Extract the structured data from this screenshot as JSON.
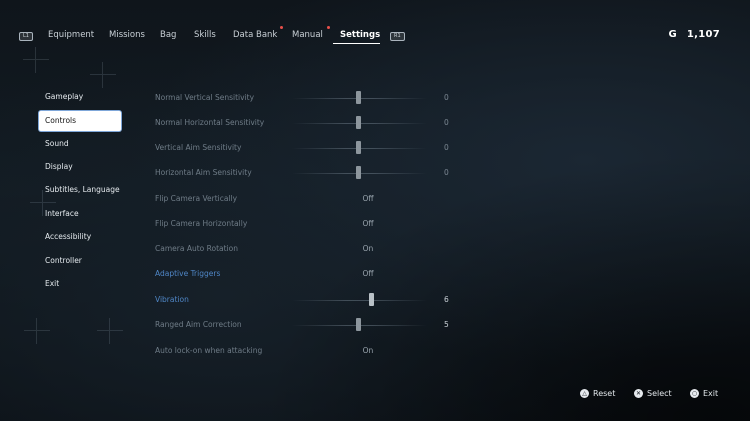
{
  "topbar": {
    "left_shoulder": "L1",
    "right_shoulder": "R1",
    "tabs": [
      {
        "label": "Equipment",
        "active": false,
        "notification": false
      },
      {
        "label": "Missions",
        "active": false,
        "notification": false
      },
      {
        "label": "Bag",
        "active": false,
        "notification": false
      },
      {
        "label": "Skills",
        "active": false,
        "notification": false
      },
      {
        "label": "Data Bank",
        "active": false,
        "notification": true
      },
      {
        "label": "Manual",
        "active": false,
        "notification": true
      },
      {
        "label": "Settings",
        "active": true,
        "notification": false
      }
    ],
    "currency": {
      "symbol": "G",
      "amount": "1,107"
    }
  },
  "sidebar": {
    "items": [
      {
        "label": "Gameplay",
        "selected": false
      },
      {
        "label": "Controls",
        "selected": true
      },
      {
        "label": "Sound",
        "selected": false
      },
      {
        "label": "Display",
        "selected": false
      },
      {
        "label": "Subtitles, Language",
        "selected": false
      },
      {
        "label": "Interface",
        "selected": false
      },
      {
        "label": "Accessibility",
        "selected": false
      },
      {
        "label": "Controller",
        "selected": false
      },
      {
        "label": "Exit",
        "selected": false
      }
    ]
  },
  "settings": {
    "rows": [
      {
        "label": "Normal Vertical Sensitivity",
        "type": "slider",
        "value": "0",
        "level": 0.5
      },
      {
        "label": "Normal Horizontal Sensitivity",
        "type": "slider",
        "value": "0",
        "level": 0.5
      },
      {
        "label": "Vertical Aim Sensitivity",
        "type": "slider",
        "value": "0",
        "level": 0.5
      },
      {
        "label": "Horizontal Aim Sensitivity",
        "type": "slider",
        "value": "0",
        "level": 0.5
      },
      {
        "label": "Flip Camera Vertically",
        "type": "option",
        "value": "Off"
      },
      {
        "label": "Flip Camera Horizontally",
        "type": "option",
        "value": "Off"
      },
      {
        "label": "Camera Auto Rotation",
        "type": "option",
        "value": "On"
      },
      {
        "label": "Adaptive Triggers",
        "type": "option",
        "value": "Off",
        "highlight": true
      },
      {
        "label": "Vibration",
        "type": "slider",
        "value": "6",
        "level": 0.6,
        "highlight": true
      },
      {
        "label": "Ranged Aim Correction",
        "type": "slider",
        "value": "5",
        "level": 0.5
      },
      {
        "label": "Auto lock-on when attacking",
        "type": "option",
        "value": "On"
      }
    ]
  },
  "footer": {
    "hints": [
      {
        "glyph": "△",
        "label": "Reset"
      },
      {
        "glyph": "✕",
        "label": "Select"
      },
      {
        "glyph": "○",
        "label": "Exit"
      }
    ]
  },
  "colors": {
    "highlight": "#4f86c6",
    "selected_bg": "#ffffff",
    "notification": "#e8504a"
  }
}
